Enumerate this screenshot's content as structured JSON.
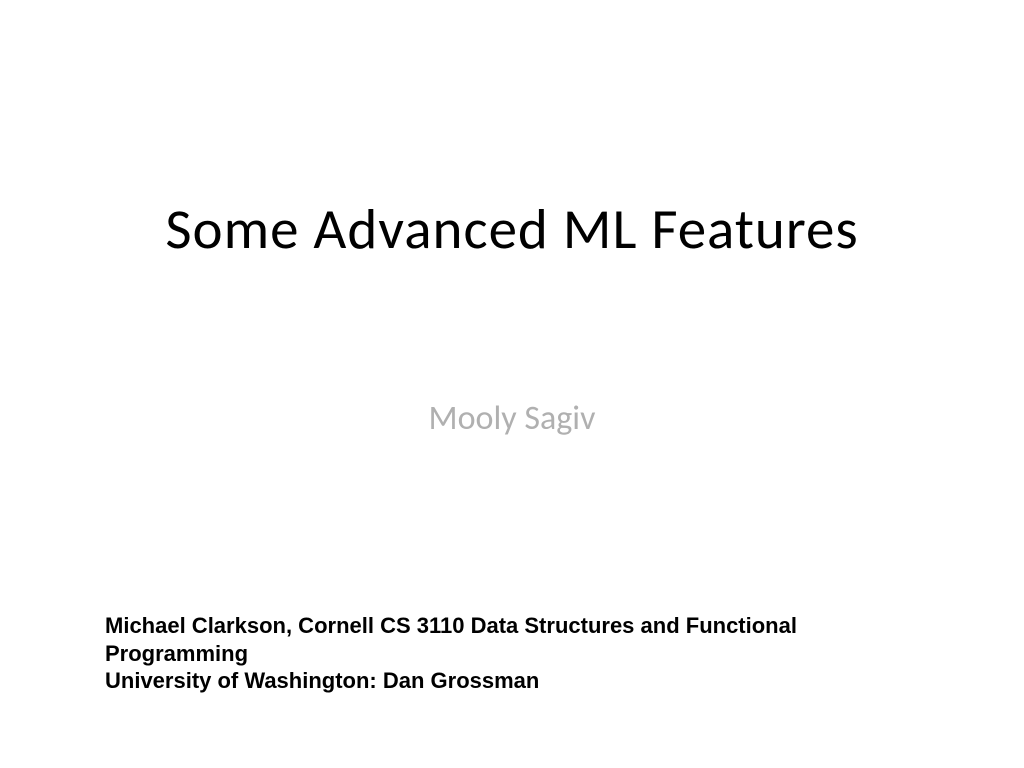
{
  "slide": {
    "title": "Some Advanced ML Features",
    "subtitle": "Mooly Sagiv",
    "footer_line1": "Michael Clarkson, Cornell CS 3110 Data Structures and Functional Programming",
    "footer_line2": "University of Washington: Dan Grossman"
  }
}
